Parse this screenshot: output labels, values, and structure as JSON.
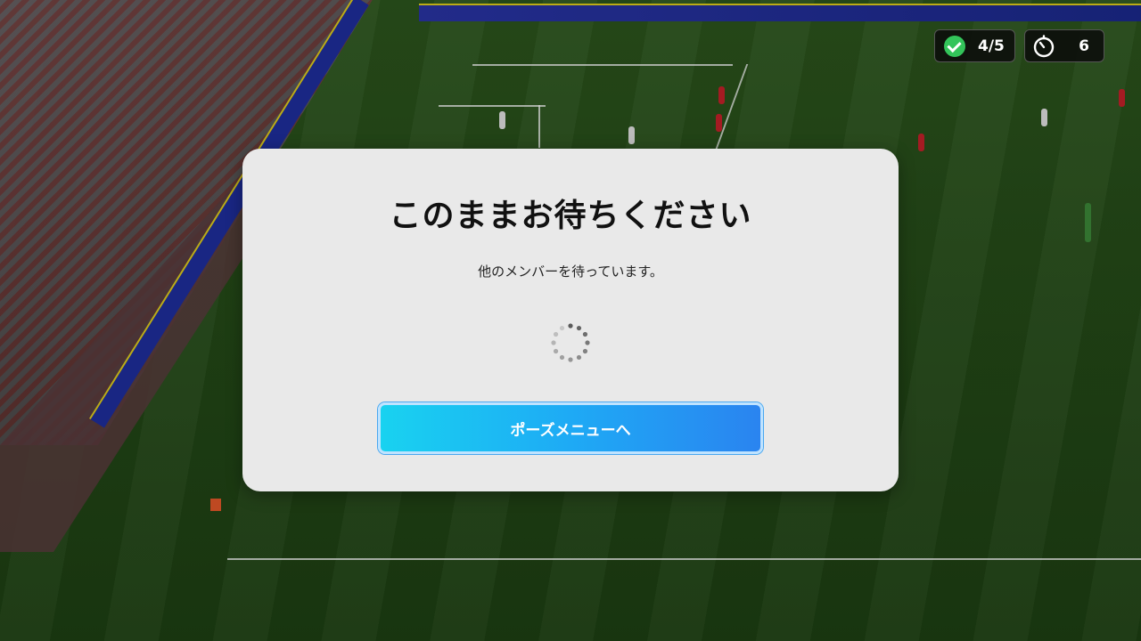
{
  "hud": {
    "ready_count": "4/5",
    "timer_value": "6",
    "ready_icon": "check-circle-icon",
    "timer_icon": "stopwatch-icon",
    "ready_color": "#33c45a"
  },
  "dialog": {
    "title": "このままお待ちください",
    "message": "他のメンバーを待っています。",
    "spinner_icon": "loading-spinner-icon",
    "button_label": "ポーズメニューへ",
    "button_gradient": [
      "#19d2f0",
      "#2a84f0"
    ]
  }
}
